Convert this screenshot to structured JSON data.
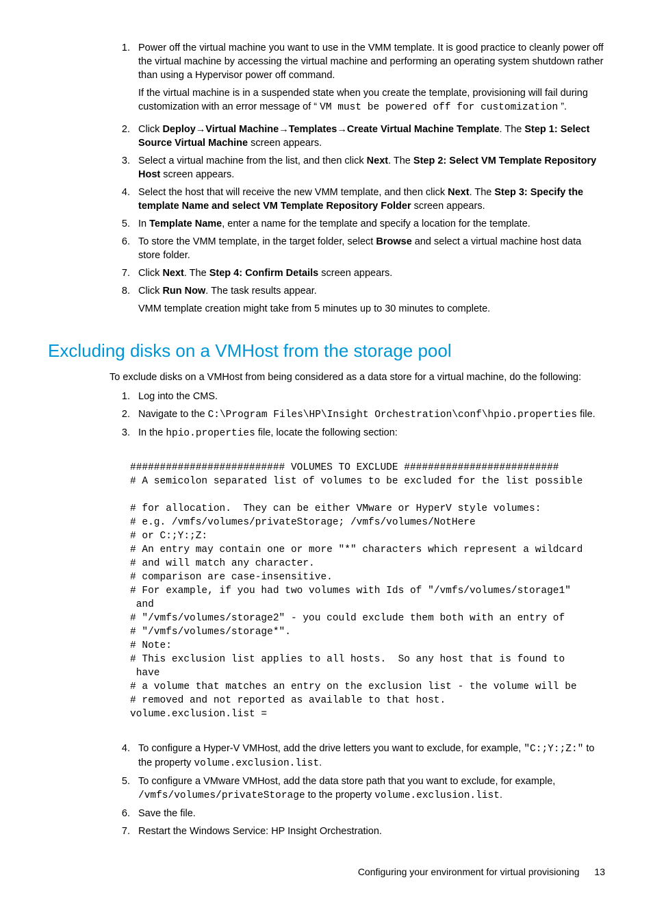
{
  "list1": {
    "items": [
      {
        "n": "1.",
        "body": "Power off the virtual machine you want to use in the VMM template. It is good practice to cleanly power off the virtual machine by accessing the virtual machine and performing an operating system shutdown rather than using a Hypervisor power off command.",
        "extra_pre": "If the virtual machine is in a suspended state when you create the template, provisioning will fail during customization with an error message of “ ",
        "extra_code": "VM must be powered off for customization",
        "extra_post": " ”."
      },
      {
        "n": "2.",
        "seg": {
          "a": "Click ",
          "b1": "Deploy",
          "arr": "→",
          "b2": "Virtual Machine",
          "b3": "Templates",
          "b4": "Create Virtual Machine Template",
          "c": ". The ",
          "b5": "Step 1: Select Source Virtual Machine",
          "d": " screen appears."
        }
      },
      {
        "n": "3.",
        "seg": {
          "a": "Select a virtual machine from the list, and then click ",
          "b1": "Next",
          "c": ". The ",
          "b2": "Step 2: Select VM Template Repository Host",
          "d": " screen appears."
        }
      },
      {
        "n": "4.",
        "seg": {
          "a": "Select the host that will receive the new VMM template, and then click ",
          "b1": "Next",
          "c": ". The ",
          "b2": "Step 3: Specify the template Name and select VM Template Repository Folder",
          "d": " screen appears."
        }
      },
      {
        "n": "5.",
        "seg": {
          "a": "In ",
          "b1": "Template Name",
          "c": ", enter a name for the template and specify a location for the template."
        }
      },
      {
        "n": "6.",
        "seg": {
          "a": "To store the VMM template, in the target folder, select ",
          "b1": "Browse",
          "c": " and select a virtual machine host data store folder."
        }
      },
      {
        "n": "7.",
        "seg": {
          "a": "Click ",
          "b1": "Next",
          "c": ". The ",
          "b2": "Step 4: Confirm Details",
          "d": " screen appears."
        }
      },
      {
        "n": "8.",
        "seg": {
          "a": "Click ",
          "b1": "Run Now",
          "c": ". The task results appear."
        },
        "extra_plain": "VMM template creation might take from 5 minutes up to 30 minutes to complete."
      }
    ]
  },
  "heading": "Excluding disks on a VMHost from the storage pool",
  "intro": "To exclude disks on a VMHost from being considered as a data store for a virtual machine, do the following:",
  "list2a": {
    "i1": {
      "n": "1.",
      "body": "Log into the CMS."
    },
    "i2": {
      "n": "2.",
      "a": "Navigate to the ",
      "code": "C:\\Program Files\\HP\\Insight Orchestration\\conf\\hpio.properties",
      "b": " file."
    },
    "i3": {
      "n": "3.",
      "a": "In the ",
      "code": "hpio.properties",
      "b": " file, locate the following section:"
    }
  },
  "codeblock": "########################## VOLUMES TO EXCLUDE ##########################\n# A semicolon separated list of volumes to be excluded for the list possible\n\n# for allocation.  They can be either VMware or HyperV style volumes:\n# e.g. /vmfs/volumes/privateStorage; /vmfs/volumes/NotHere\n# or C:;Y:;Z:\n# An entry may contain one or more \"*\" characters which represent a wildcard\n# and will match any character.\n# comparison are case-insensitive.\n# For example, if you had two volumes with Ids of \"/vmfs/volumes/storage1\"\n and\n# \"/vmfs/volumes/storage2\" - you could exclude them both with an entry of\n# \"/vmfs/volumes/storage*\".\n# Note:\n# This exclusion list applies to all hosts.  So any host that is found to\n have\n# a volume that matches an entry on the exclusion list - the volume will be\n# removed and not reported as available to that host.\nvolume.exclusion.list =",
  "list2b": {
    "i4": {
      "n": "4.",
      "a": "To configure a Hyper-V VMHost, add the drive letters you want to exclude, for example, ",
      "code1": "\"C:;Y:;Z:\"",
      "b": " to the property ",
      "code2": "volume.exclusion.list",
      "c": "."
    },
    "i5": {
      "n": "5.",
      "a": "To configure a VMware VMHost, add the data store path that you want to exclude, for example, ",
      "code1": "/vmfs/volumes/privateStorage",
      "b": " to the property ",
      "code2": "volume.exclusion.list",
      "c": "."
    },
    "i6": {
      "n": "6.",
      "body": "Save the file."
    },
    "i7": {
      "n": "7.",
      "body": "Restart the Windows Service: HP Insight Orchestration."
    }
  },
  "footer": {
    "title": "Configuring your environment for virtual provisioning",
    "page": "13"
  }
}
